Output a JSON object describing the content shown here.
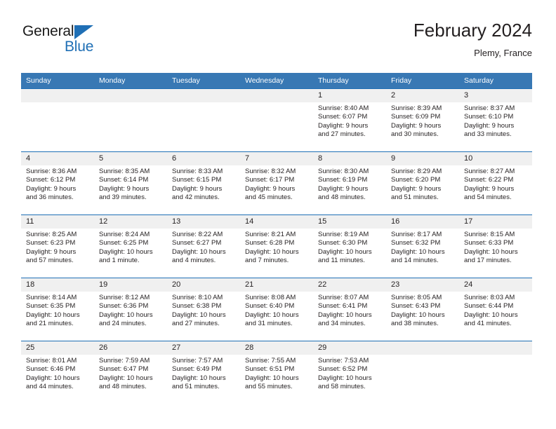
{
  "brand": {
    "name_top": "General",
    "name_bottom": "Blue",
    "accent_color": "#1f6fb5"
  },
  "header": {
    "title": "February 2024",
    "subtitle": "Plemy, France"
  },
  "theme": {
    "header_bg": "#3878b4",
    "row_border": "#1f6fb5",
    "daynum_bg": "#f0f0f0",
    "text": "#231f20"
  },
  "weekday_headers": [
    "Sunday",
    "Monday",
    "Tuesday",
    "Wednesday",
    "Thursday",
    "Friday",
    "Saturday"
  ],
  "weeks": [
    [
      {
        "day": "",
        "sunrise": "",
        "sunset": "",
        "daylight1": "",
        "daylight2": ""
      },
      {
        "day": "",
        "sunrise": "",
        "sunset": "",
        "daylight1": "",
        "daylight2": ""
      },
      {
        "day": "",
        "sunrise": "",
        "sunset": "",
        "daylight1": "",
        "daylight2": ""
      },
      {
        "day": "",
        "sunrise": "",
        "sunset": "",
        "daylight1": "",
        "daylight2": ""
      },
      {
        "day": "1",
        "sunrise": "Sunrise: 8:40 AM",
        "sunset": "Sunset: 6:07 PM",
        "daylight1": "Daylight: 9 hours",
        "daylight2": "and 27 minutes."
      },
      {
        "day": "2",
        "sunrise": "Sunrise: 8:39 AM",
        "sunset": "Sunset: 6:09 PM",
        "daylight1": "Daylight: 9 hours",
        "daylight2": "and 30 minutes."
      },
      {
        "day": "3",
        "sunrise": "Sunrise: 8:37 AM",
        "sunset": "Sunset: 6:10 PM",
        "daylight1": "Daylight: 9 hours",
        "daylight2": "and 33 minutes."
      }
    ],
    [
      {
        "day": "4",
        "sunrise": "Sunrise: 8:36 AM",
        "sunset": "Sunset: 6:12 PM",
        "daylight1": "Daylight: 9 hours",
        "daylight2": "and 36 minutes."
      },
      {
        "day": "5",
        "sunrise": "Sunrise: 8:35 AM",
        "sunset": "Sunset: 6:14 PM",
        "daylight1": "Daylight: 9 hours",
        "daylight2": "and 39 minutes."
      },
      {
        "day": "6",
        "sunrise": "Sunrise: 8:33 AM",
        "sunset": "Sunset: 6:15 PM",
        "daylight1": "Daylight: 9 hours",
        "daylight2": "and 42 minutes."
      },
      {
        "day": "7",
        "sunrise": "Sunrise: 8:32 AM",
        "sunset": "Sunset: 6:17 PM",
        "daylight1": "Daylight: 9 hours",
        "daylight2": "and 45 minutes."
      },
      {
        "day": "8",
        "sunrise": "Sunrise: 8:30 AM",
        "sunset": "Sunset: 6:19 PM",
        "daylight1": "Daylight: 9 hours",
        "daylight2": "and 48 minutes."
      },
      {
        "day": "9",
        "sunrise": "Sunrise: 8:29 AM",
        "sunset": "Sunset: 6:20 PM",
        "daylight1": "Daylight: 9 hours",
        "daylight2": "and 51 minutes."
      },
      {
        "day": "10",
        "sunrise": "Sunrise: 8:27 AM",
        "sunset": "Sunset: 6:22 PM",
        "daylight1": "Daylight: 9 hours",
        "daylight2": "and 54 minutes."
      }
    ],
    [
      {
        "day": "11",
        "sunrise": "Sunrise: 8:25 AM",
        "sunset": "Sunset: 6:23 PM",
        "daylight1": "Daylight: 9 hours",
        "daylight2": "and 57 minutes."
      },
      {
        "day": "12",
        "sunrise": "Sunrise: 8:24 AM",
        "sunset": "Sunset: 6:25 PM",
        "daylight1": "Daylight: 10 hours",
        "daylight2": "and 1 minute."
      },
      {
        "day": "13",
        "sunrise": "Sunrise: 8:22 AM",
        "sunset": "Sunset: 6:27 PM",
        "daylight1": "Daylight: 10 hours",
        "daylight2": "and 4 minutes."
      },
      {
        "day": "14",
        "sunrise": "Sunrise: 8:21 AM",
        "sunset": "Sunset: 6:28 PM",
        "daylight1": "Daylight: 10 hours",
        "daylight2": "and 7 minutes."
      },
      {
        "day": "15",
        "sunrise": "Sunrise: 8:19 AM",
        "sunset": "Sunset: 6:30 PM",
        "daylight1": "Daylight: 10 hours",
        "daylight2": "and 11 minutes."
      },
      {
        "day": "16",
        "sunrise": "Sunrise: 8:17 AM",
        "sunset": "Sunset: 6:32 PM",
        "daylight1": "Daylight: 10 hours",
        "daylight2": "and 14 minutes."
      },
      {
        "day": "17",
        "sunrise": "Sunrise: 8:15 AM",
        "sunset": "Sunset: 6:33 PM",
        "daylight1": "Daylight: 10 hours",
        "daylight2": "and 17 minutes."
      }
    ],
    [
      {
        "day": "18",
        "sunrise": "Sunrise: 8:14 AM",
        "sunset": "Sunset: 6:35 PM",
        "daylight1": "Daylight: 10 hours",
        "daylight2": "and 21 minutes."
      },
      {
        "day": "19",
        "sunrise": "Sunrise: 8:12 AM",
        "sunset": "Sunset: 6:36 PM",
        "daylight1": "Daylight: 10 hours",
        "daylight2": "and 24 minutes."
      },
      {
        "day": "20",
        "sunrise": "Sunrise: 8:10 AM",
        "sunset": "Sunset: 6:38 PM",
        "daylight1": "Daylight: 10 hours",
        "daylight2": "and 27 minutes."
      },
      {
        "day": "21",
        "sunrise": "Sunrise: 8:08 AM",
        "sunset": "Sunset: 6:40 PM",
        "daylight1": "Daylight: 10 hours",
        "daylight2": "and 31 minutes."
      },
      {
        "day": "22",
        "sunrise": "Sunrise: 8:07 AM",
        "sunset": "Sunset: 6:41 PM",
        "daylight1": "Daylight: 10 hours",
        "daylight2": "and 34 minutes."
      },
      {
        "day": "23",
        "sunrise": "Sunrise: 8:05 AM",
        "sunset": "Sunset: 6:43 PM",
        "daylight1": "Daylight: 10 hours",
        "daylight2": "and 38 minutes."
      },
      {
        "day": "24",
        "sunrise": "Sunrise: 8:03 AM",
        "sunset": "Sunset: 6:44 PM",
        "daylight1": "Daylight: 10 hours",
        "daylight2": "and 41 minutes."
      }
    ],
    [
      {
        "day": "25",
        "sunrise": "Sunrise: 8:01 AM",
        "sunset": "Sunset: 6:46 PM",
        "daylight1": "Daylight: 10 hours",
        "daylight2": "and 44 minutes."
      },
      {
        "day": "26",
        "sunrise": "Sunrise: 7:59 AM",
        "sunset": "Sunset: 6:47 PM",
        "daylight1": "Daylight: 10 hours",
        "daylight2": "and 48 minutes."
      },
      {
        "day": "27",
        "sunrise": "Sunrise: 7:57 AM",
        "sunset": "Sunset: 6:49 PM",
        "daylight1": "Daylight: 10 hours",
        "daylight2": "and 51 minutes."
      },
      {
        "day": "28",
        "sunrise": "Sunrise: 7:55 AM",
        "sunset": "Sunset: 6:51 PM",
        "daylight1": "Daylight: 10 hours",
        "daylight2": "and 55 minutes."
      },
      {
        "day": "29",
        "sunrise": "Sunrise: 7:53 AM",
        "sunset": "Sunset: 6:52 PM",
        "daylight1": "Daylight: 10 hours",
        "daylight2": "and 58 minutes."
      },
      {
        "day": "",
        "sunrise": "",
        "sunset": "",
        "daylight1": "",
        "daylight2": ""
      },
      {
        "day": "",
        "sunrise": "",
        "sunset": "",
        "daylight1": "",
        "daylight2": ""
      }
    ]
  ]
}
